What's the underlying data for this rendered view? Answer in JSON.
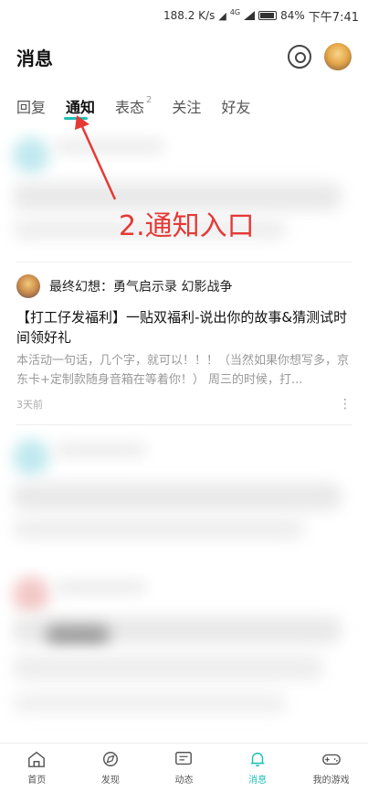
{
  "status_bar": {
    "speed": "188.2 K/s",
    "net": "4G",
    "battery": "84%",
    "time": "下午7:41"
  },
  "header": {
    "title": "消息"
  },
  "tabs": [
    {
      "label": "回复"
    },
    {
      "label": "通知"
    },
    {
      "label": "表态",
      "badge": "2"
    },
    {
      "label": "关注"
    },
    {
      "label": "好友"
    }
  ],
  "annotation": "2.通知入口",
  "notice": {
    "game": "最终幻想：勇气启示录 幻影战争",
    "title": "【打工仔发福利】一贴双福利-说出你的故事&猜测试时间领好礼",
    "desc": "本活动一句话，几个字，就可以！！！（当然如果你想写多，京东卡+定制款随身音箱在等着你！） 周三的时候，打...",
    "time": "3天前",
    "more": "⋮"
  },
  "nav": [
    {
      "label": "首页",
      "icon": "home-icon"
    },
    {
      "label": "发现",
      "icon": "compass-icon"
    },
    {
      "label": "动态",
      "icon": "chat-icon"
    },
    {
      "label": "消息",
      "icon": "bell-icon"
    },
    {
      "label": "我的游戏",
      "icon": "gamepad-icon"
    }
  ],
  "accent_color": "#1fc0b4"
}
